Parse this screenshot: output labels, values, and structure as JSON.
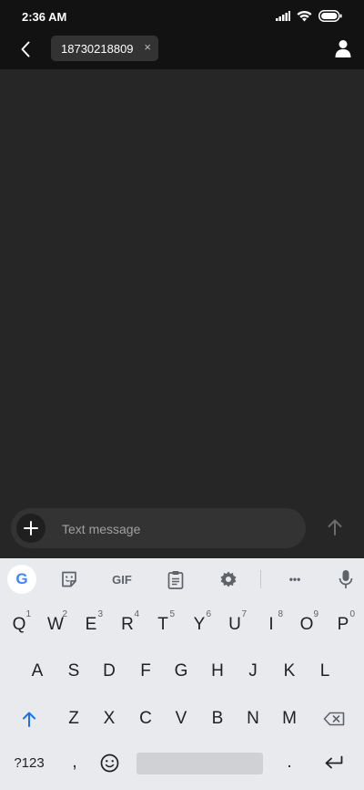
{
  "status": {
    "time": "2:36 AM"
  },
  "header": {
    "recipient": "18730218809",
    "chip_close": "×"
  },
  "compose": {
    "placeholder": "Text message"
  },
  "keyboard_toolbar": {
    "google": "G",
    "gif": "GIF",
    "more": "•••"
  },
  "keyboard": {
    "row1": [
      {
        "label": "Q",
        "hint": "1"
      },
      {
        "label": "W",
        "hint": "2"
      },
      {
        "label": "E",
        "hint": "3"
      },
      {
        "label": "R",
        "hint": "4"
      },
      {
        "label": "T",
        "hint": "5"
      },
      {
        "label": "Y",
        "hint": "6"
      },
      {
        "label": "U",
        "hint": "7"
      },
      {
        "label": "I",
        "hint": "8"
      },
      {
        "label": "O",
        "hint": "9"
      },
      {
        "label": "P",
        "hint": "0"
      }
    ],
    "row2": [
      "A",
      "S",
      "D",
      "F",
      "G",
      "H",
      "J",
      "K",
      "L"
    ],
    "row3": [
      "Z",
      "X",
      "C",
      "V",
      "B",
      "N",
      "M"
    ],
    "symbols": "?123",
    "comma": ",",
    "period": "."
  },
  "colors": {
    "accent": "#1a73e8",
    "background": "#262626",
    "bar": "#121212",
    "keyboard": "#e8eaed"
  }
}
